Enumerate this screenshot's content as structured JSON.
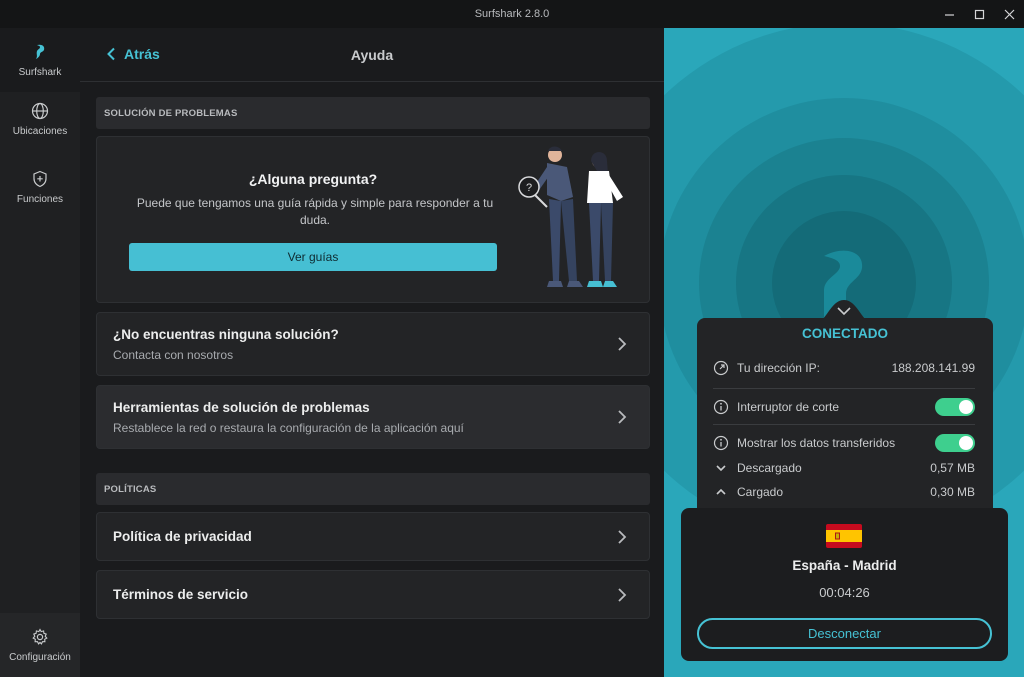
{
  "window": {
    "title": "Surfshark 2.8.0"
  },
  "sidebar": {
    "brand": "Surfshark",
    "items": [
      {
        "label": "Ubicaciones",
        "icon": "globe-icon"
      },
      {
        "label": "Funciones",
        "icon": "shield-plus-icon"
      }
    ],
    "settings_label": "Configuración"
  },
  "header": {
    "back_label": "Atrás",
    "title": "Ayuda"
  },
  "troubleshooting": {
    "section_label": "SOLUCIÓN DE PROBLEMAS",
    "help_card": {
      "title": "¿Alguna pregunta?",
      "description": "Puede que tengamos una guía rápida y simple para responder a tu duda.",
      "button_label": "Ver guías"
    },
    "rows": [
      {
        "title": "¿No encuentras ninguna solución?",
        "subtitle": "Contacta con nosotros"
      },
      {
        "title": "Herramientas de solución de problemas",
        "subtitle": "Restablece la red o restaura la configuración de la aplicación aquí"
      }
    ]
  },
  "policies": {
    "section_label": "POLÍTICAS",
    "rows": [
      {
        "title": "Política de privacidad"
      },
      {
        "title": "Términos de servicio"
      }
    ]
  },
  "connection": {
    "status": "CONECTADO",
    "ip_label": "Tu dirección IP:",
    "ip_value": "188.208.141.99",
    "kill_switch_label": "Interruptor de corte",
    "kill_switch_on": true,
    "show_data_label": "Mostrar los datos transferidos",
    "show_data_on": true,
    "download_label": "Descargado",
    "download_value": "0,57 MB",
    "upload_label": "Cargado",
    "upload_value": "0,30 MB"
  },
  "location": {
    "name": "España - Madrid",
    "elapsed": "00:04:26",
    "disconnect_label": "Desconectar"
  },
  "colors": {
    "accent": "#46c2d4",
    "toggle_on": "#3ecf8e",
    "panel_bg": "#2aa7ba"
  }
}
